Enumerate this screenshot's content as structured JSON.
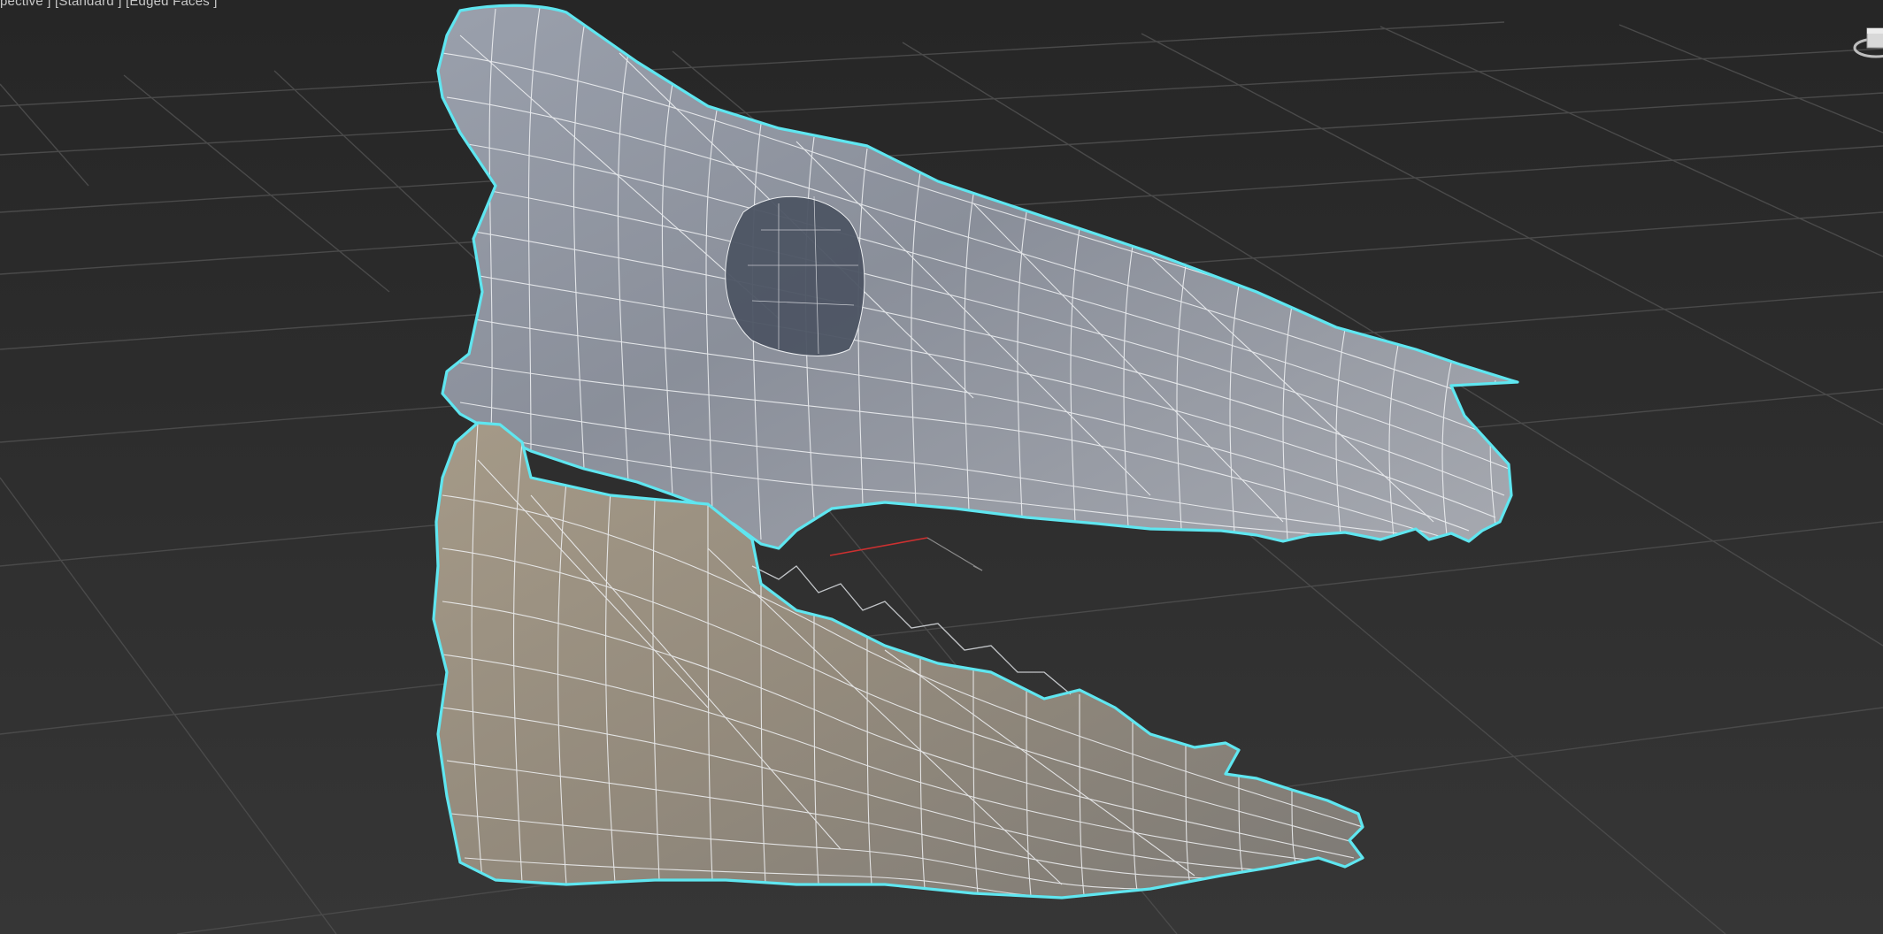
{
  "viewport": {
    "label": "pective ] [Standard ] [Edged Faces ]",
    "view_name": "Perspective",
    "shading": "Standard",
    "display_mode": "Edged Faces"
  },
  "scene": {
    "object": "animal skull with separated lower jaw",
    "selection_outline_color": "#5fe6f0",
    "wire_color": "#f2f4f6",
    "upper_skull_tint": "#8c93a0",
    "lower_jaw_tint": "#9c9282",
    "grid_color": "#4a4a4a",
    "background_color": "#2f2f2f"
  },
  "icons": {
    "viewcube": "viewcube-icon",
    "pivot_gizmo": "transform-gizmo-icon"
  }
}
